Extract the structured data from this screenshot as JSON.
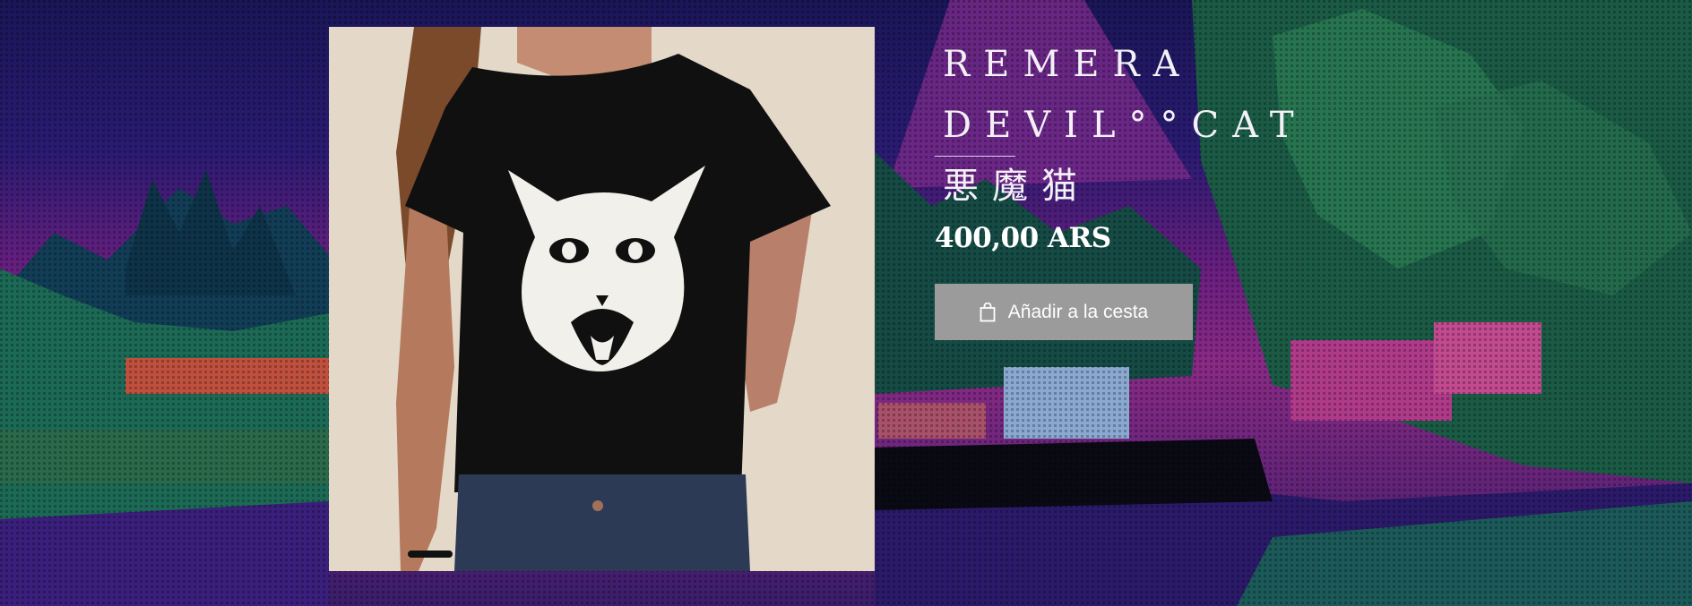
{
  "product": {
    "title": "REMERA DEVIL°°CAT 悪魔猫",
    "price": "400,00 ARS",
    "image_alt_icon": "product-photo"
  },
  "cart_button": {
    "label": "Añadir a la cesta",
    "icon": "shopping-bag-icon"
  },
  "colors": {
    "button_bg": "#9b9b9b",
    "text": "#ffffff",
    "bg_sky_top": "#1f1a5f",
    "bg_magenta": "#7e1f7a",
    "bg_green": "#1f6b4a"
  }
}
